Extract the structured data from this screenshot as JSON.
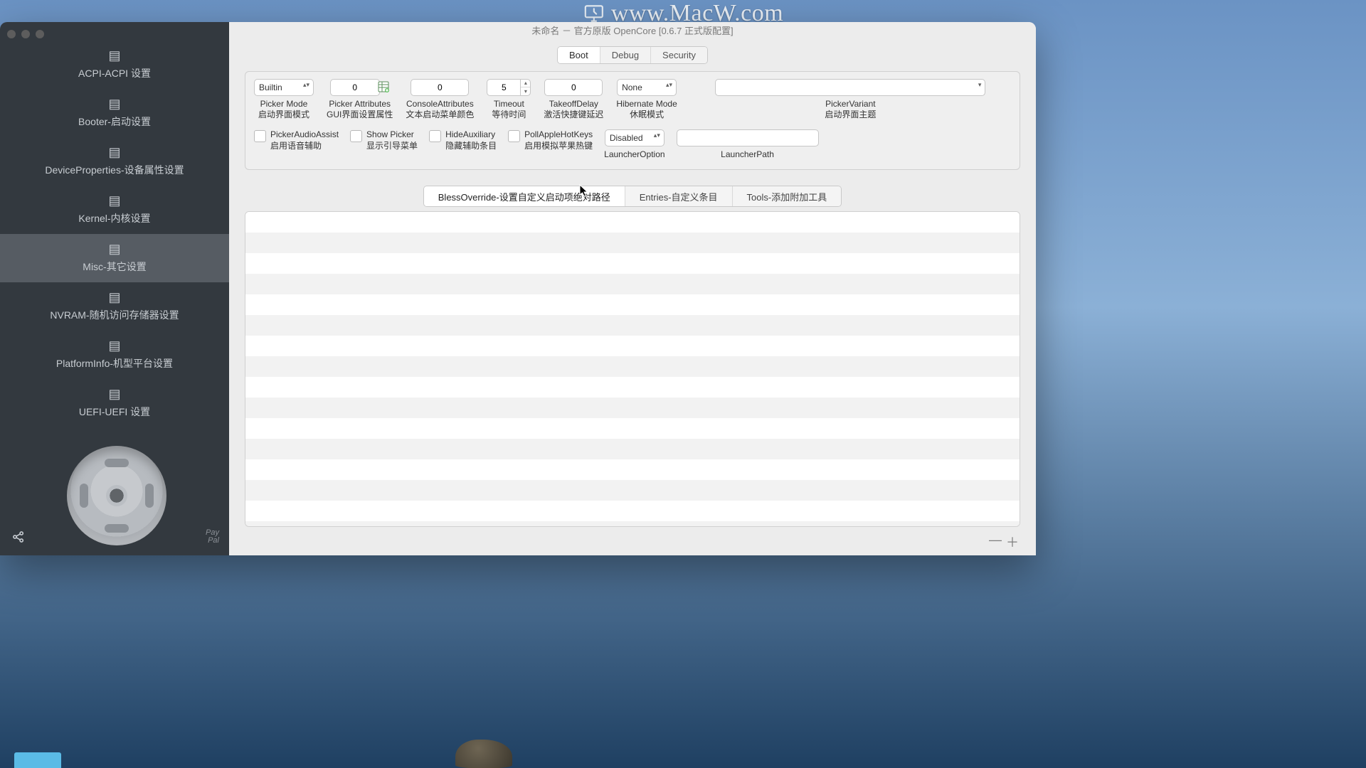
{
  "watermark": "www.MacW.com",
  "window_title": "未命名 － 官方原版 OpenCore [0.6.7 正式版配置]",
  "sidebar": {
    "items": [
      {
        "label": "ACPI-ACPI 设置"
      },
      {
        "label": "Booter-启动设置"
      },
      {
        "label": "DeviceProperties-设备属性设置"
      },
      {
        "label": "Kernel-内核设置"
      },
      {
        "label": "Misc-其它设置"
      },
      {
        "label": "NVRAM-随机访问存储器设置"
      },
      {
        "label": "PlatformInfo-机型平台设置"
      },
      {
        "label": "UEFI-UEFI 设置"
      }
    ],
    "selected_index": 4,
    "paypal": "Pay\nPal"
  },
  "top_tabs": {
    "items": [
      "Boot",
      "Debug",
      "Security"
    ],
    "active": 0
  },
  "fields": {
    "picker_mode": {
      "value": "Builtin",
      "label": "Picker Mode",
      "sub": "启动界面模式"
    },
    "picker_attrs": {
      "value": "0",
      "label": "Picker Attributes",
      "sub": "GUI界面设置属性"
    },
    "console_attrs": {
      "value": "0",
      "label": "ConsoleAttributes",
      "sub": "文本启动菜单颜色"
    },
    "timeout": {
      "value": "5",
      "label": "Timeout",
      "sub": "等待时间"
    },
    "takeoff_delay": {
      "value": "0",
      "label": "TakeoffDelay",
      "sub": "激活快捷键延迟"
    },
    "hibernate_mode": {
      "value": "None",
      "label": "Hibernate Mode",
      "sub": "休眠模式"
    },
    "picker_variant": {
      "value": "",
      "label": "PickerVariant",
      "sub": "启动界面主题"
    },
    "launcher_option": {
      "value": "Disabled",
      "label": "LauncherOption"
    },
    "launcher_path": {
      "value": "",
      "label": "LauncherPath"
    }
  },
  "checks": {
    "picker_audio": {
      "label": "PickerAudioAssist",
      "sub": "启用语音辅助"
    },
    "show_picker": {
      "label": "Show Picker",
      "sub": "显示引导菜单"
    },
    "hide_aux": {
      "label": "HideAuxiliary",
      "sub": "隐藏辅助条目"
    },
    "poll_hotkeys": {
      "label": "PollAppleHotKeys",
      "sub": "启用模拟苹果热键"
    }
  },
  "sub_tabs": {
    "items": [
      "BlessOverride-设置自定义启动项绝对路径",
      "Entries-自定义条目",
      "Tools-添加附加工具"
    ],
    "active": 0
  },
  "buttons": {
    "remove": "—",
    "add": "＋"
  }
}
